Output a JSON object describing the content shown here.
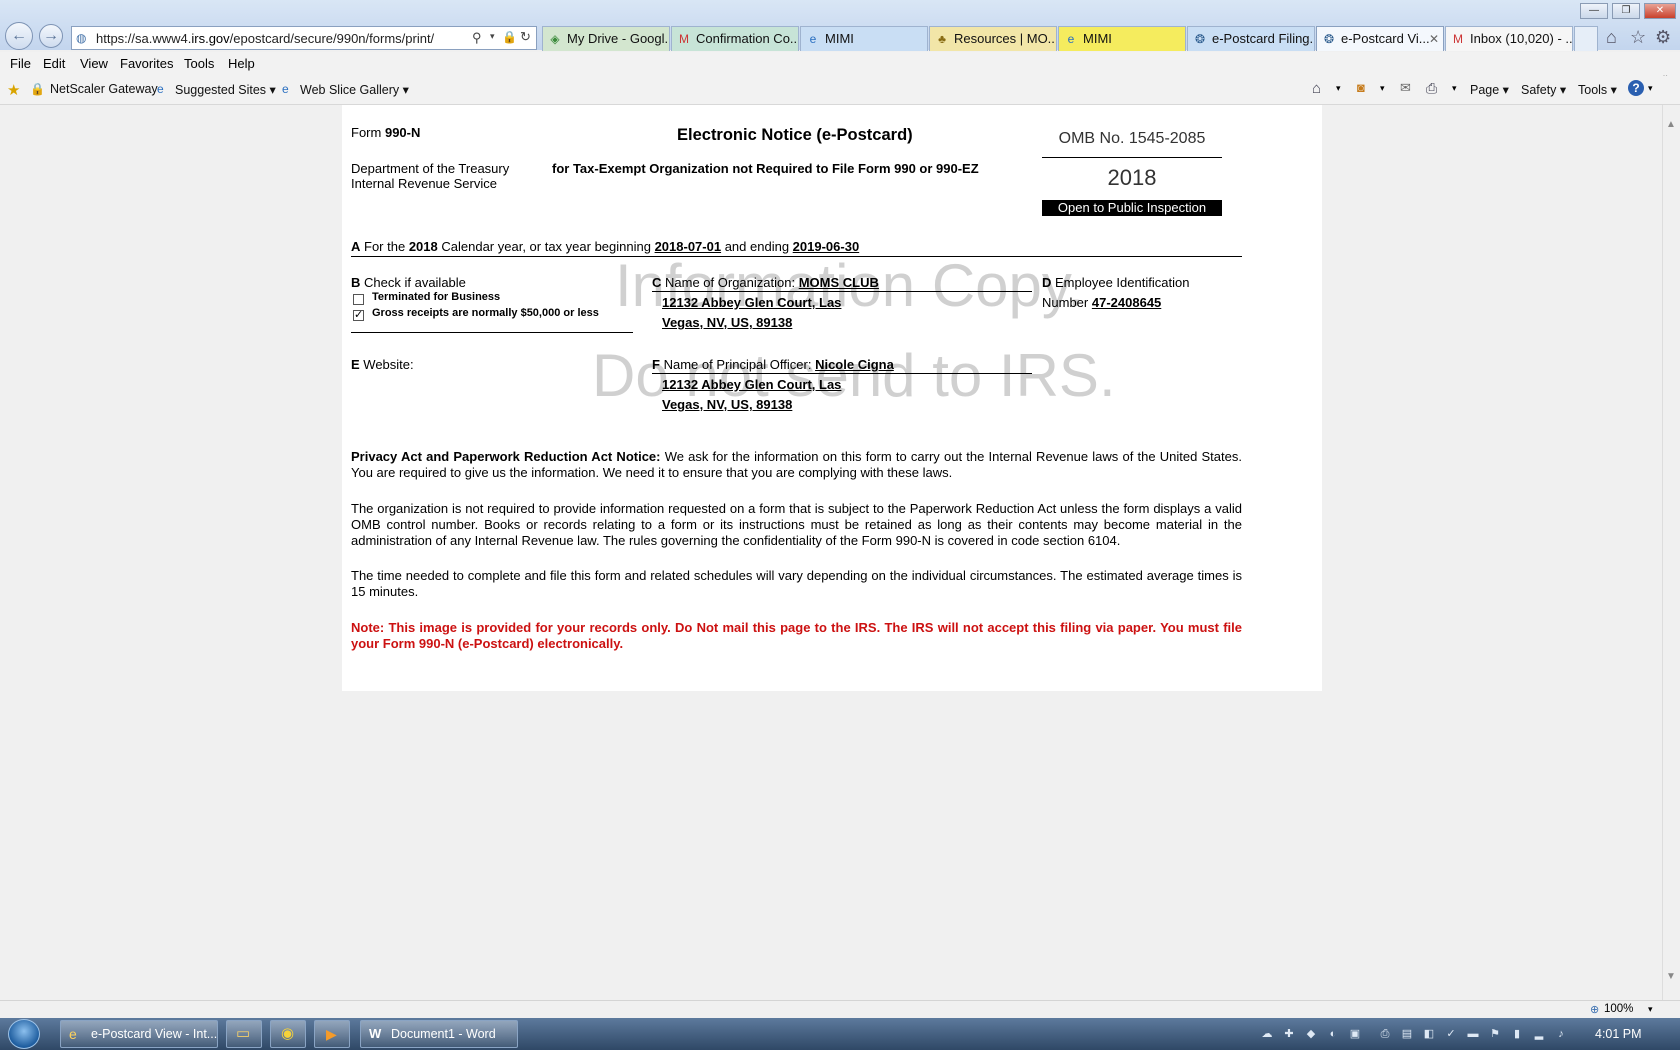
{
  "browser": {
    "url_prefix": "https://sa.www4.",
    "url_domain": "irs.gov",
    "url_path": "/epostcard/secure/990n/forms/print/",
    "tabs": [
      {
        "label": "My Drive - Googl...",
        "icon": "drive-icon"
      },
      {
        "label": "Confirmation Co...",
        "icon": "gmail-icon"
      },
      {
        "label": "MIMI",
        "icon": "ie-icon"
      },
      {
        "label": "Resources | MO...",
        "icon": "resource-icon"
      },
      {
        "label": "MIMI",
        "icon": "ie-icon"
      },
      {
        "label": "e-Postcard Filing...",
        "icon": "irs-icon"
      },
      {
        "label": "e-Postcard Vi...",
        "icon": "irs-icon",
        "active": true
      },
      {
        "label": "Inbox (10,020) - ...",
        "icon": "gmail-icon"
      }
    ],
    "menu": [
      "File",
      "Edit",
      "View",
      "Favorites",
      "Tools",
      "Help"
    ],
    "favorites": [
      "NetScaler Gateway",
      "Suggested Sites ▾",
      "Web Slice Gallery ▾"
    ],
    "commands": [
      "Page ▾",
      "Safety ▾",
      "Tools ▾"
    ],
    "zoom": "100%"
  },
  "form": {
    "form_label": "Form",
    "form_number": "990-N",
    "title": "Electronic Notice (e-Postcard)",
    "subtitle": "for Tax-Exempt Organization not Required to File Form 990 or 990-EZ",
    "dept_line1": "Department of the Treasury",
    "dept_line2": "Internal Revenue Service",
    "omb": "OMB No. 1545-2085",
    "year": "2018",
    "open_public": "Open to Public Inspection",
    "sectionA": {
      "letter": "A",
      "text1": "For the",
      "year": "2018",
      "text2": "Calendar year, or tax year beginning",
      "begin": "2018-07-01",
      "text3": "and ending",
      "end": "2019-06-30"
    },
    "sectionB": {
      "letter": "B",
      "label": "Check if available",
      "option1": "Terminated for Business",
      "option1_checked": false,
      "option2": "Gross receipts are normally $50,000 or less",
      "option2_checked": true
    },
    "sectionC": {
      "letter": "C",
      "label": "Name of Organization:",
      "name": "MOMS CLUB",
      "addr1": "12132 Abbey Glen Court, Las",
      "addr2": "Vegas, NV, US, 89138"
    },
    "sectionD": {
      "letter": "D",
      "label1": "Employee Identification",
      "label2": "Number",
      "ein": "47-2408645"
    },
    "sectionE": {
      "letter": "E",
      "label": "Website:"
    },
    "sectionF": {
      "letter": "F",
      "label": "Name of Principal Officer:",
      "name": "Nicole Cigna",
      "addr1": "12132 Abbey Glen Court, Las",
      "addr2": "Vegas, NV, US, 89138"
    },
    "watermark1": "Information Copy.",
    "watermark2": "Do not send to IRS.",
    "privacy_heading": "Privacy Act and Paperwork Reduction Act Notice:",
    "privacy_text": "We ask for the information on this form to carry out the Internal Revenue laws of the United States. You are required to give us the information. We need it to ensure that you are complying with these laws.",
    "para2": "The organization is not required to provide information requested on a form that is subject to the Paperwork Reduction Act unless the form displays a valid OMB control number. Books or records relating to a form or its instructions must be retained as long as their contents may become material in the administration of any Internal Revenue law. The rules governing the confidentiality of the Form 990-N is covered in code section 6104.",
    "para3": "The time needed to complete and file this form and related schedules will vary depending on the individual circumstances. The estimated average times is 15 minutes.",
    "note": "Note: This image is provided for your records only. Do Not mail this page to the IRS. The IRS will not accept this filing via paper. You must file your Form 990-N (e-Postcard) electronically."
  },
  "taskbar": {
    "items": [
      "e-Postcard View - Int...",
      "",
      "",
      "",
      "Document1 - Word"
    ],
    "clock": "4:01 PM"
  },
  "colors": {
    "note_red": "#cc1111",
    "titlebar": "#c9daf0",
    "taskbar": "#3d5877"
  }
}
